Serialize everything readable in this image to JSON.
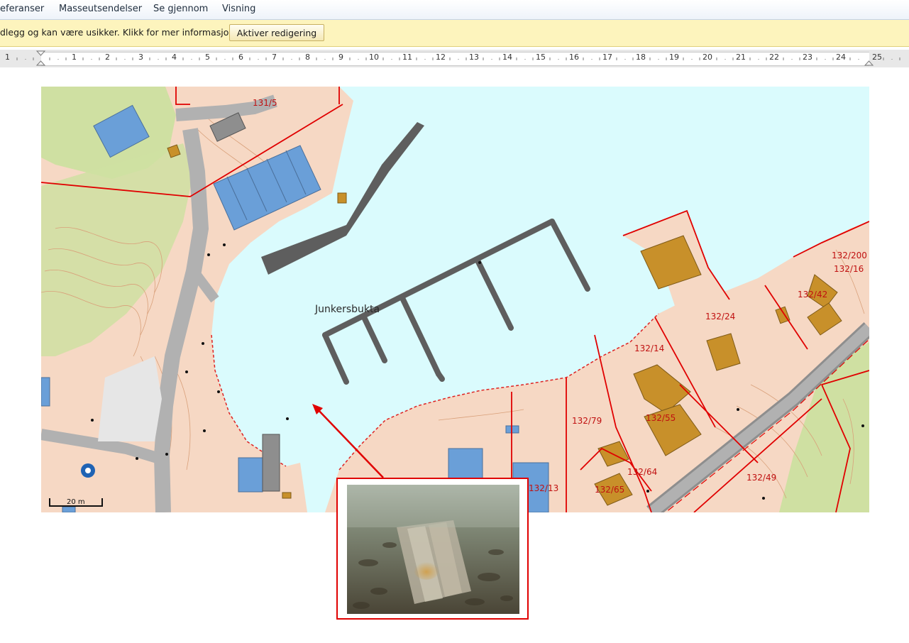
{
  "ribbon": {
    "tabs": [
      {
        "label": "eferanser"
      },
      {
        "label": "Masseutsendelser"
      },
      {
        "label": "Se gjennom"
      },
      {
        "label": "Visning"
      }
    ]
  },
  "message_bar": {
    "text": "dlegg og kan være usikker. Klikk for mer informasjon.",
    "button_label": "Aktiver redigering"
  },
  "ruler": {
    "numbers": [
      "1",
      "1",
      "2",
      "3",
      "4",
      "5",
      "6",
      "7",
      "8",
      "9",
      "10",
      "11",
      "12",
      "13",
      "14",
      "15",
      "16",
      "17",
      "18",
      "19",
      "20",
      "21",
      "22",
      "23",
      "24",
      "25"
    ]
  },
  "map": {
    "place_name": "Junkersbukta",
    "scale_label": "20 m",
    "parcels": [
      "131/5",
      "132/200",
      "132/16",
      "132/42",
      "132/24",
      "132/14",
      "132/79",
      "132/55",
      "132/64",
      "132/65",
      "132/13",
      "132/49"
    ],
    "colors": {
      "water": "#dafbfd",
      "land": "#f6d8c4",
      "forest": "#cfe0a2",
      "road": "#b1b1b1",
      "building_blue": "#6a9fd8",
      "building_brown": "#c8902a",
      "boundary": "#e00000",
      "pier": "#5e5e5e"
    }
  },
  "callout": {
    "border_color": "#e00000"
  }
}
